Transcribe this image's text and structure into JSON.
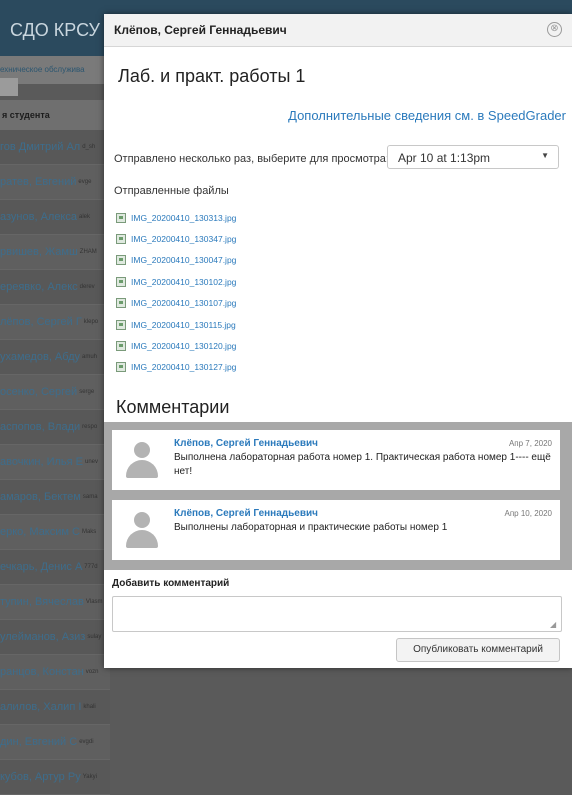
{
  "background": {
    "app_title": "СДО КРСУ",
    "subnav": "ехническое обслужива",
    "column_header": "я студента",
    "students": [
      {
        "name": "гов Дмитрий Ал",
        "login": "d_sh"
      },
      {
        "name": "ратев, Евгений",
        "login": "evge"
      },
      {
        "name": "азунов, Алекса",
        "login": "alek"
      },
      {
        "name": "рвишев, Жамш",
        "login": "ZHAM"
      },
      {
        "name": "ереявко, Алекс",
        "login": "derev"
      },
      {
        "name": "лёпов, Сергей Г",
        "login": "klepo"
      },
      {
        "name": "ухамедов, Абду",
        "login": "amuh"
      },
      {
        "name": "осенко, Сергей",
        "login": "serge"
      },
      {
        "name": "аспопов, Влади",
        "login": "respo"
      },
      {
        "name": "авочкин, Илья Е",
        "login": "unev"
      },
      {
        "name": "амаров, Бектем",
        "login": "sama"
      },
      {
        "name": "ерко, Максим С",
        "login": "Maks"
      },
      {
        "name": "ечкарь, Денис А",
        "login": "777d"
      },
      {
        "name": "тупин, Вячеслав",
        "login": "Vlasm"
      },
      {
        "name": "улейманов, Азиз",
        "login": "sulay"
      },
      {
        "name": "ранцов, Констан",
        "login": "vozn"
      },
      {
        "name": "алилов, Халип I",
        "login": "khali"
      },
      {
        "name": "дин, Евгений С",
        "login": "evgdi"
      },
      {
        "name": "кубов, Артур Ру",
        "login": "Yakyi"
      }
    ]
  },
  "modal": {
    "title": "Клёпов, Сергей Геннадьевич",
    "close_symbol": "⊗",
    "assignment_title": "Лаб. и практ. работы 1",
    "speedgrader_link": "Дополнительные сведения см. в SpeedGrader",
    "submission_label": "Отправлено несколько раз, выберите для просмотра:",
    "submission_selected": "Apr 10 at 1:13pm",
    "files_label": "Отправленные файлы",
    "files": [
      "IMG_20200410_130313.jpg",
      "IMG_20200410_130347.jpg",
      "IMG_20200410_130047.jpg",
      "IMG_20200410_130102.jpg",
      "IMG_20200410_130107.jpg",
      "IMG_20200410_130115.jpg",
      "IMG_20200410_130120.jpg",
      "IMG_20200410_130127.jpg"
    ],
    "comments_title": "Комментарии",
    "comments": [
      {
        "author": "Клёпов, Сергей Геннадьевич",
        "date": "Апр 7, 2020",
        "text": "Выполнена лабораторная работа номер 1. Практическая работа номер 1---- ещё нет!"
      },
      {
        "author": "Клёпов, Сергей Геннадьевич",
        "date": "Апр 10, 2020",
        "text": "Выполнены лабораторная и практические работы номер 1"
      }
    ],
    "add_comment_label": "Добавить комментарий",
    "publish_button": "Опубликовать комментарий"
  }
}
